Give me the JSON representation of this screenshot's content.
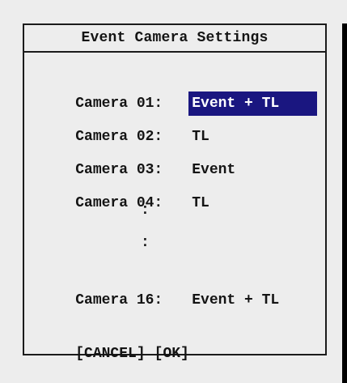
{
  "dialog": {
    "title": "Event Camera Settings"
  },
  "cameras": [
    {
      "label": "Camera 01:",
      "value": "Event + TL",
      "selected": true
    },
    {
      "label": "Camera 02:",
      "value": "TL",
      "selected": false
    },
    {
      "label": "Camera 03:",
      "value": "Event",
      "selected": false
    },
    {
      "label": "Camera 04:",
      "value": "TL",
      "selected": false
    },
    {
      "label": "Camera 16:",
      "value": "Event + TL",
      "selected": false
    }
  ],
  "ellipsis": [
    ":",
    ":"
  ],
  "actions": {
    "cancel_label": "[CANCEL]",
    "ok_label": "[OK]"
  },
  "colors": {
    "background": "#ededed",
    "border": "#1b1b1b",
    "selection": "#1a1680",
    "selection_text": "#ffffff"
  }
}
